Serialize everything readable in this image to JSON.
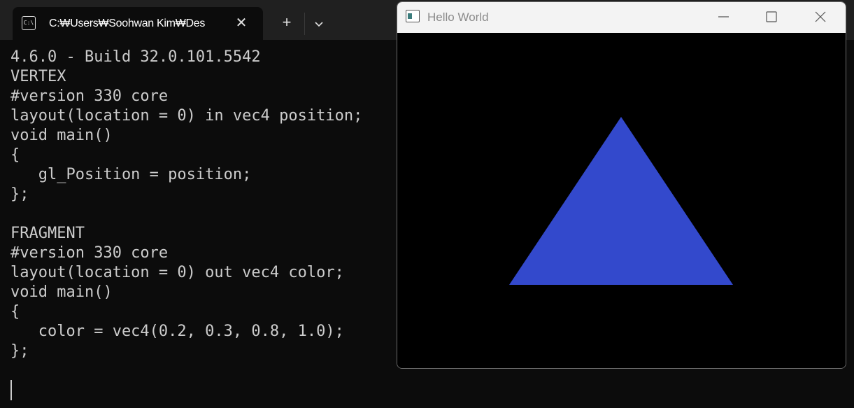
{
  "terminal": {
    "tab_title": "C:₩Users₩Soohwan Kim₩Des",
    "tab_icon_glyph": "C:\\",
    "new_tab_glyph": "+",
    "close_glyph": "✕",
    "lines": [
      "4.6.0 - Build 32.0.101.5542",
      "VERTEX",
      "#version 330 core",
      "layout(location = 0) in vec4 position;",
      "void main()",
      "{",
      "   gl_Position = position;",
      "};",
      "",
      "FRAGMENT",
      "#version 330 core",
      "layout(location = 0) out vec4 color;",
      "void main()",
      "{",
      "   color = vec4(0.2, 0.3, 0.8, 1.0);",
      "};"
    ]
  },
  "gl_window": {
    "title": "Hello World",
    "triangle_color": "#3349cc",
    "background_color": "#000000"
  }
}
